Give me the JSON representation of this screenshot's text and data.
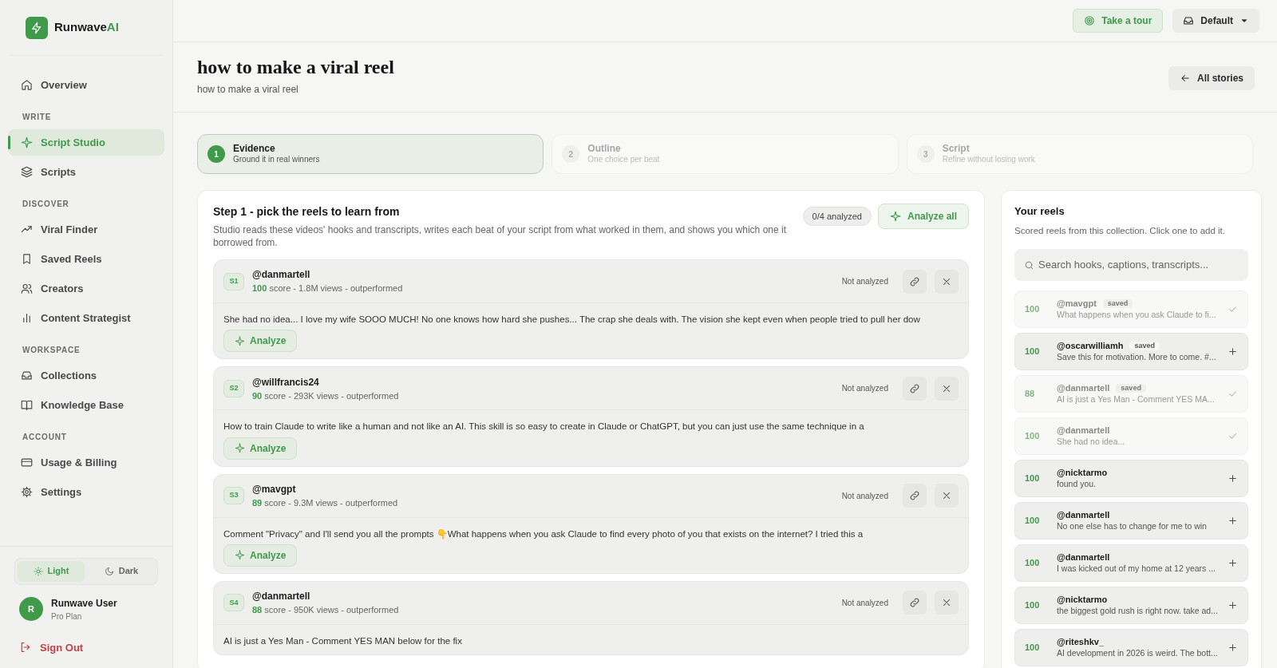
{
  "brand": {
    "name": "Runwave",
    "accent": "AI"
  },
  "sidebar": {
    "sections": [
      {
        "items": [
          {
            "label": "Overview",
            "selected": false
          }
        ]
      },
      {
        "heading": "WRITE",
        "items": [
          {
            "label": "Script Studio",
            "selected": true
          },
          {
            "label": "Scripts",
            "selected": false
          }
        ]
      },
      {
        "heading": "DISCOVER",
        "items": [
          {
            "label": "Viral Finder",
            "selected": false
          },
          {
            "label": "Saved Reels",
            "selected": false
          },
          {
            "label": "Creators",
            "selected": false
          },
          {
            "label": "Content Strategist",
            "selected": false
          }
        ]
      },
      {
        "heading": "WORKSPACE",
        "items": [
          {
            "label": "Collections",
            "selected": false
          },
          {
            "label": "Knowledge Base",
            "selected": false
          }
        ]
      },
      {
        "heading": "ACCOUNT",
        "items": [
          {
            "label": "Usage & Billing",
            "selected": false
          },
          {
            "label": "Settings",
            "selected": false
          }
        ]
      }
    ],
    "theme": [
      {
        "label": "Light",
        "selected": true
      },
      {
        "label": "Dark",
        "selected": false
      }
    ],
    "user": {
      "initial": "R",
      "name": "Runwave User",
      "plan": "Pro Plan"
    },
    "sign_out": "Sign Out"
  },
  "topbar": {
    "tour": "Take a tour",
    "workspace": "Default"
  },
  "header": {
    "title": "how to make a viral reel",
    "subtitle": "how to make a viral reel",
    "back": "All stories"
  },
  "steps": [
    {
      "number": "1",
      "title": "Evidence",
      "caption": "Ground it in real winners",
      "selected": true
    },
    {
      "number": "2",
      "title": "Outline",
      "caption": "One choice per beat",
      "selected": false
    },
    {
      "number": "3",
      "title": "Script",
      "caption": "Refine without losing work",
      "selected": false
    }
  ],
  "evidence": {
    "title": "Step 1 - pick the reels to learn from",
    "description": "Studio reads these videos' hooks and transcripts, writes each beat of your script from what worked in them, and shows you which one it borrowed from.",
    "progress": "0/4 analyzed",
    "analyze_all": "Analyze all",
    "reels": [
      {
        "tag": "S1",
        "handle": "@danmartell",
        "score": "100",
        "meta": "score - 1.8M views - outperformed",
        "status": "Not analyzed",
        "text": "She had no idea... I love my wife SOOO MUCH! No one knows how hard she pushes... The crap she deals with. The vision she kept even when people tried to pull her dow",
        "action": "Analyze"
      },
      {
        "tag": "S2",
        "handle": "@willfrancis24",
        "score": "90",
        "meta": "score - 293K views - outperformed",
        "status": "Not analyzed",
        "text": "How to train Claude to write like a human and not like an AI. This skill is so easy to create in Claude or ChatGPT, but you can just use the same technique in a",
        "action": "Analyze"
      },
      {
        "tag": "S3",
        "handle": "@mavgpt",
        "score": "89",
        "meta": "score - 9.3M views - outperformed",
        "status": "Not analyzed",
        "text": "Comment \"Privacy\" and I'll send you all the prompts 👇What happens when you ask Claude to find every photo of you that exists on the internet? I tried this a",
        "action": "Analyze"
      },
      {
        "tag": "S4",
        "handle": "@danmartell",
        "score": "88",
        "meta": "score - 950K views - outperformed",
        "status": "Not analyzed",
        "text": "AI is just a Yes Man - Comment YES MAN below for the fix"
      }
    ]
  },
  "your_reels": {
    "title": "Your reels",
    "description": "Scored reels from this collection. Click one to add it.",
    "search_placeholder": "Search hooks, captions, transcripts...",
    "items": [
      {
        "score": "100",
        "handle": "@mavgpt",
        "badge": "saved",
        "snippet": "What happens when you ask Claude to fi...",
        "added": true
      },
      {
        "score": "100",
        "handle": "@oscarwilliamh",
        "badge": "saved",
        "snippet": "Save this for motivation. More to come. #...",
        "added": false
      },
      {
        "score": "88",
        "handle": "@danmartell",
        "badge": "saved",
        "snippet": "AI is just a Yes Man - Comment YES MA...",
        "added": true
      },
      {
        "score": "100",
        "handle": "@danmartell",
        "snippet": "She had no idea...",
        "added": true
      },
      {
        "score": "100",
        "handle": "@nicktarmo",
        "snippet": "found you.",
        "added": false
      },
      {
        "score": "100",
        "handle": "@danmartell",
        "snippet": "No one else has to change for me to win",
        "added": false
      },
      {
        "score": "100",
        "handle": "@danmartell",
        "snippet": "I was kicked out of my home at 12 years ...",
        "added": false
      },
      {
        "score": "100",
        "handle": "@nicktarmo",
        "snippet": "the biggest gold rush is right now. take ad...",
        "added": false
      },
      {
        "score": "100",
        "handle": "@riteshkv_",
        "snippet": "AI development in 2026 is weird. The bott...",
        "added": false
      }
    ]
  }
}
